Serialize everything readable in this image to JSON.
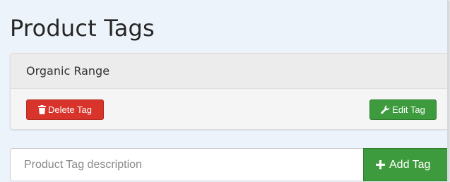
{
  "page": {
    "title": "Product Tags"
  },
  "tag": {
    "name": "Organic Range",
    "delete_label": "Delete Tag",
    "edit_label": "Edit Tag"
  },
  "add_form": {
    "description_placeholder": "Product Tag description",
    "description_value": "",
    "add_label": "Add Tag"
  },
  "icons": {
    "delete": "trash-icon",
    "edit": "wrench-icon",
    "add": "plus-icon"
  },
  "colors": {
    "danger": "#d9342b",
    "success": "#3d9a3d",
    "background": "#edf3fa"
  }
}
